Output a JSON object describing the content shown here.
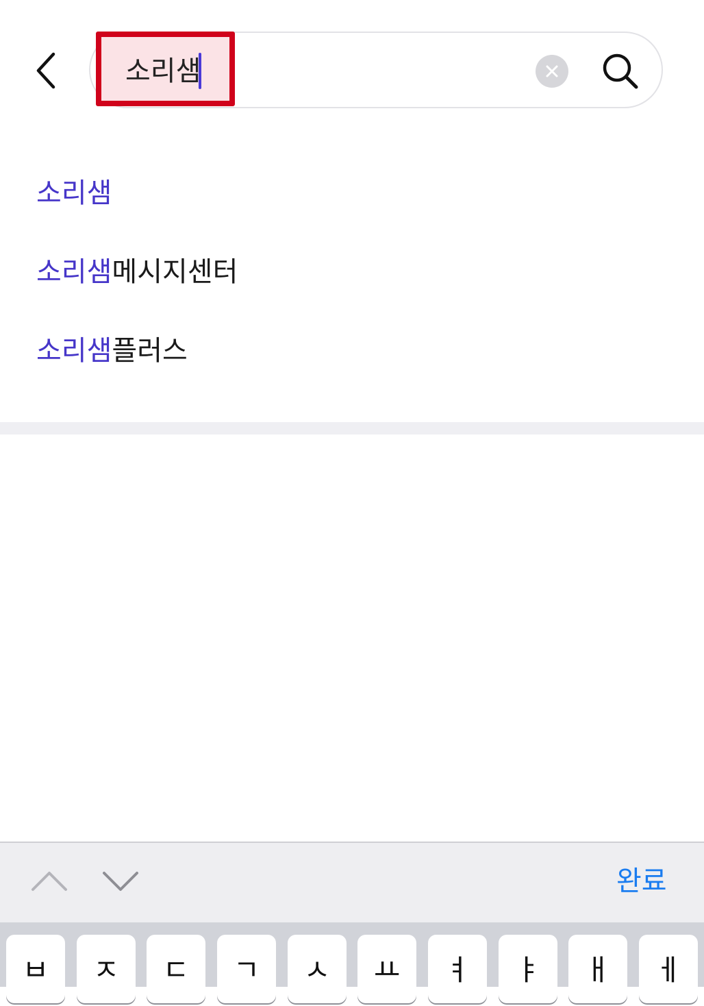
{
  "search": {
    "query": "소리샘"
  },
  "suggestions": [
    {
      "match": "소리샘",
      "rest": ""
    },
    {
      "match": "소리샘",
      "rest": "메시지센터"
    },
    {
      "match": "소리샘",
      "rest": "플러스"
    }
  ],
  "keyboard_toolbar": {
    "done_label": "완료"
  },
  "keyboard": {
    "keys": [
      "ㅂ",
      "ㅈ",
      "ㄷ",
      "ㄱ",
      "ㅅ",
      "ㅛ",
      "ㅕ",
      "ㅑ",
      "ㅐ",
      "ㅔ"
    ]
  },
  "colors": {
    "accent_match": "#4636c9",
    "highlight_border": "#d0021b",
    "done_blue": "#1a7cf0"
  }
}
